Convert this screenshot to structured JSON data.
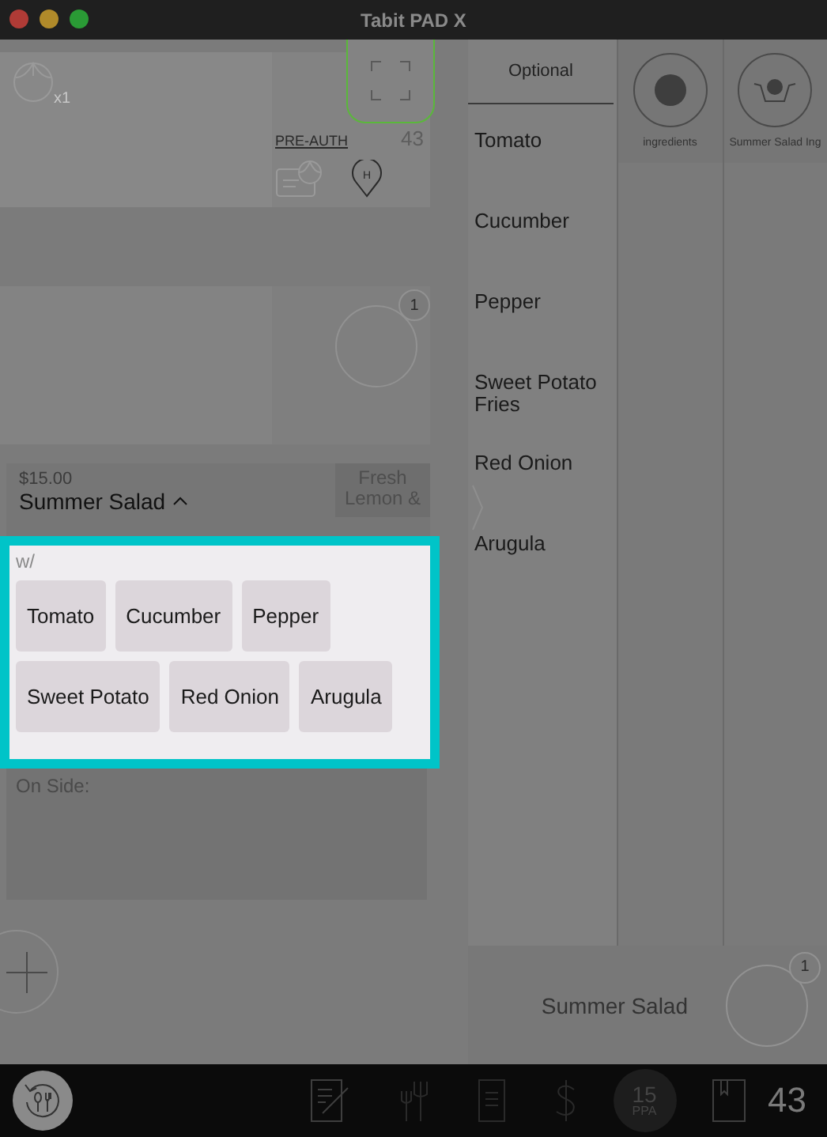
{
  "window": {
    "title": "Tabit PAD X"
  },
  "order_card": {
    "seat_count": "x1",
    "pre_auth": "PRE-AUTH",
    "table_number": "43",
    "pin_label": "H"
  },
  "second_card": {
    "badge": "1"
  },
  "item": {
    "price": "$15.00",
    "name": "Summer Salad",
    "expanded": true,
    "tag": "Fresh Lemon &"
  },
  "modifiers": {
    "label": "w/",
    "items": [
      {
        "label": "Tomato"
      },
      {
        "label": "Cucumber"
      },
      {
        "label": "Pepper"
      },
      {
        "label": "Sweet Potato"
      },
      {
        "label": "Red Onion"
      },
      {
        "label": "Arugula"
      }
    ]
  },
  "on_side": {
    "label": "On Side:"
  },
  "optional": {
    "title": "Optional",
    "items": [
      {
        "label": "Tomato"
      },
      {
        "label": "Cucumber"
      },
      {
        "label": "Pepper"
      },
      {
        "label": "Sweet Potato Fries"
      },
      {
        "label": "Red Onion"
      },
      {
        "label": "Arugula"
      }
    ]
  },
  "categories": [
    {
      "label": "ingredients",
      "kind": "dot"
    },
    {
      "label": "Summer Salad Ing",
      "kind": "bowl"
    }
  ],
  "order_summary": {
    "name": "Summer Salad",
    "badge": "1"
  },
  "toolbar": {
    "ppa_value": "15",
    "ppa_label": "PPA",
    "table_number": "43"
  }
}
